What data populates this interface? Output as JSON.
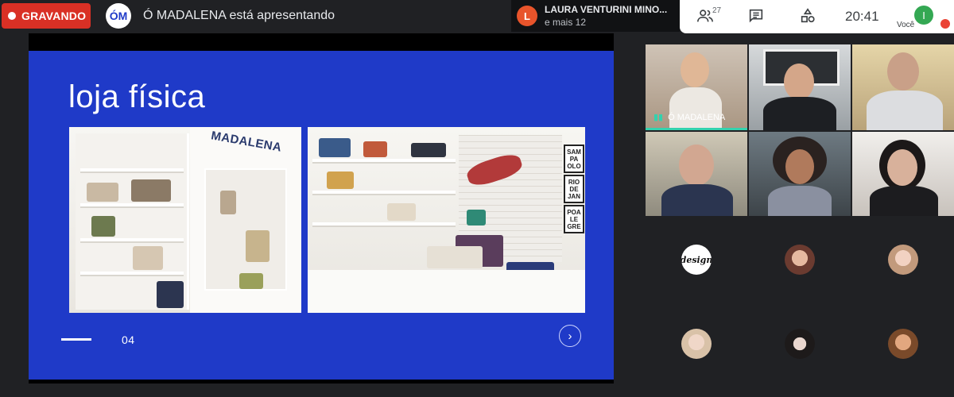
{
  "recording": {
    "label": "GRAVANDO"
  },
  "presenter": {
    "logo_text": "ÓM",
    "text": "Ó MADALENA está apresentando"
  },
  "notification": {
    "avatar_letter": "L",
    "title": "LAURA VENTURINI MINO...",
    "subtitle": "e mais 12"
  },
  "controls": {
    "participants_count": "27",
    "time": "20:41",
    "self_avatar_letter": "I",
    "self_label": "Você",
    "icons": [
      "people-icon",
      "chat-icon",
      "activities-icon",
      "mic-off-icon"
    ]
  },
  "slide": {
    "title": "loja física",
    "brand_sign": "MADALENA",
    "frames": [
      "SAM\nPA\nOLO",
      "RIO\nDE\nJAN",
      "POA\nLE\nGRE"
    ],
    "page_number": "04",
    "next_icon": "chevron-right-icon"
  },
  "participants": {
    "speaker_name": "Ó MADALENA",
    "avatars": [
      "design-logo",
      "avatar-woman-1",
      "avatar-woman-2",
      "avatar-woman-3",
      "avatar-woman-4",
      "avatar-woman-5"
    ],
    "avatar_logo_text": "design"
  },
  "colors": {
    "recording_red": "#d93025",
    "slide_blue": "#1f3ac8",
    "speaking_green": "#33d2ae",
    "meet_dark": "#202124"
  }
}
